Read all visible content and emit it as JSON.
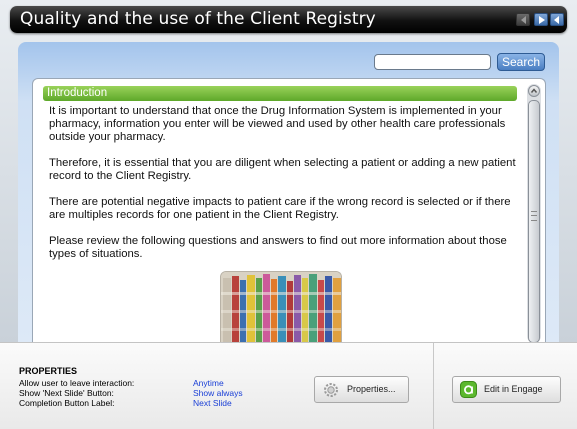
{
  "window": {
    "title": "Quality and the use of the Client Registry"
  },
  "search": {
    "placeholder": "",
    "button_label": "Search"
  },
  "content": {
    "section_title": "Introduction",
    "paragraphs": [
      "It is important to understand that once the Drug Information System is implemented in your pharmacy, information you enter will be viewed and used by other health care professionals outside your pharmacy.",
      "Therefore, it is essential that you are diligent when selecting a patient or adding a new patient record to the Client Registry.",
      "There are potential negative impacts to patient care if the wrong record is selected or if there are multiples records for one patient in the Client Registry.",
      "Please review the following questions and answers to find out more information about those types of situations."
    ]
  },
  "properties": {
    "heading": "PROPERTIES",
    "rows": [
      {
        "label": "Allow user to leave interaction:",
        "value": "Anytime"
      },
      {
        "label": "Show 'Next Slide' Button:",
        "value": "Show always"
      },
      {
        "label": "Completion Button Label:",
        "value": "Next Slide"
      }
    ],
    "properties_button": "Properties...",
    "engage_button": "Edit in Engage"
  },
  "colors": {
    "header_green": "#6bb534",
    "value_blue": "#1a3fd6",
    "accent_blue": "#4a7ec2"
  },
  "icons": {
    "prev": "prev-slide-icon",
    "play": "play-icon",
    "next": "next-slide-icon",
    "gear": "gear-icon",
    "engage": "engage-logo-icon"
  }
}
